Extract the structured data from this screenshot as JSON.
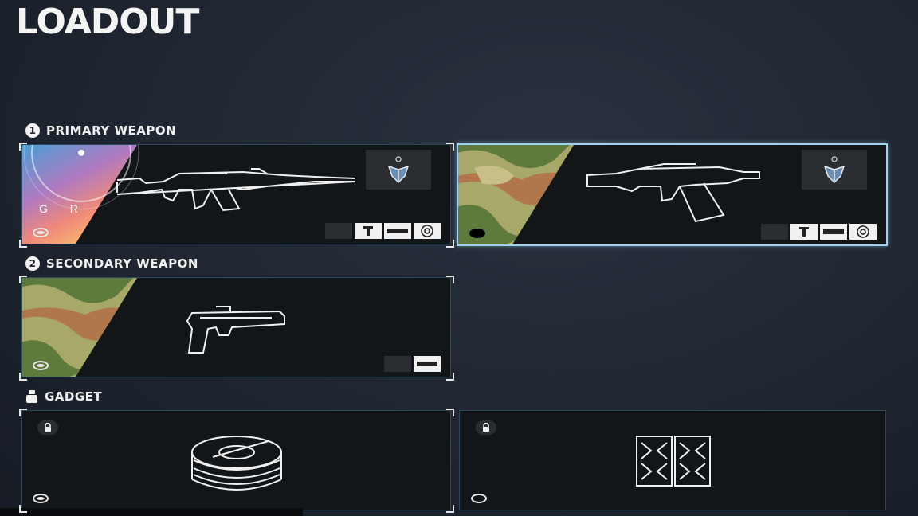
{
  "page": {
    "title": "LOADOUT"
  },
  "sections": {
    "primary": {
      "number": "1",
      "label": "PRIMARY WEAPON"
    },
    "secondary": {
      "number": "2",
      "label": "SECONDARY WEAPON"
    },
    "gadget": {
      "label": "GADGET"
    }
  },
  "primary_cards": [
    {
      "skin_letters": "G R",
      "skin": "gradient-sunset",
      "selected": false,
      "icons": [
        "charm-icon",
        "grip-icon",
        "barrel-icon",
        "scope-icon"
      ]
    },
    {
      "skin": "camo",
      "selected": true,
      "icons": [
        "charm-icon",
        "grip-icon",
        "barrel-icon",
        "scope-icon"
      ]
    }
  ],
  "secondary_card": {
    "skin": "camo",
    "icons": [
      "barrel-icon"
    ]
  },
  "gadget_cards": [
    {
      "item": "barbed-wire-icon",
      "locked": true,
      "selected": true
    },
    {
      "item": "deployable-shield-icon",
      "locked": true,
      "selected": false
    }
  ],
  "colors": {
    "accent": "#9fd3ef",
    "border": "#2a4a5c",
    "card_bg": "#131619"
  }
}
